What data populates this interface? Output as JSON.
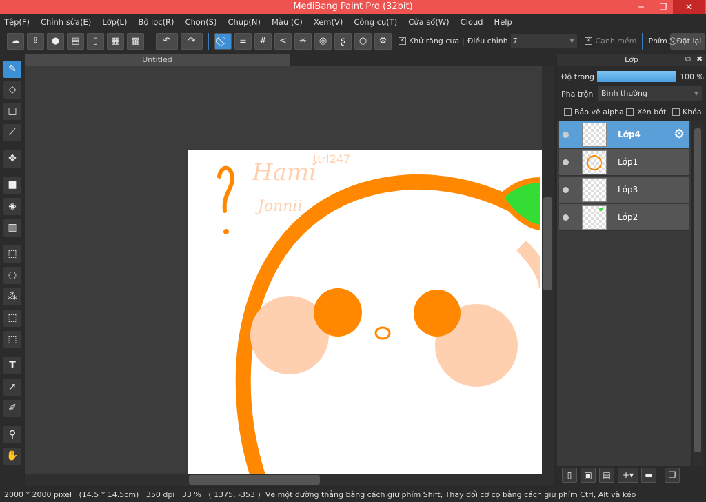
{
  "window": {
    "title": "MediBang Paint Pro (32bit)"
  },
  "menu": [
    "Tệp(F)",
    "Chỉnh sửa(E)",
    "Lớp(L)",
    "Bộ lọc(R)",
    "Chọn(S)",
    "Chụp(N)",
    "Màu (C)",
    "Xem(V)",
    "Công cụ(T)",
    "Cửa sổ(W)",
    "Cloud",
    "Help"
  ],
  "toolbar": {
    "antialias_label": "Khử răng cưa",
    "adjust_label": "Điều chỉnh",
    "adjust_value": "7",
    "soft_edge_label": "Cạnh mềm",
    "key_label": "Phím",
    "reset_label": "Đặt lại"
  },
  "document": {
    "tab": "Untitled",
    "canvas_text": [
      "Hami",
      "ttrl247",
      "Jonnii"
    ]
  },
  "layers_panel": {
    "title": "Lớp",
    "opacity_label": "Độ trong",
    "opacity_value": "100 %",
    "opacity": 100,
    "blend_label": "Pha trộn",
    "blend_value": "Bình thường",
    "protect_alpha": "Bảo vệ alpha",
    "clipping": "Xén bớt",
    "lock": "Khóa",
    "layers": [
      {
        "name": "Lớp4",
        "selected": true
      },
      {
        "name": "Lớp1",
        "selected": false
      },
      {
        "name": "Lớp3",
        "selected": false
      },
      {
        "name": "Lớp2",
        "selected": false
      }
    ]
  },
  "status": {
    "size": "2000 * 2000 pixel",
    "physical": "(14.5 * 14.5cm)",
    "dpi": "350 dpi",
    "zoom": "33 %",
    "coords": "( 1375, -353 )",
    "hint": "Vẽ một đường thẳng bằng cách giữ phím Shift, Thay đổi cỡ cọ bằng cách giữ phím Ctrl, Alt và kéo"
  },
  "colors": {
    "titlebar": "#ef5350",
    "accent": "#3d8fd6",
    "orange": "#ff8800",
    "peach": "#ffd0b0",
    "green": "#33dd33"
  }
}
